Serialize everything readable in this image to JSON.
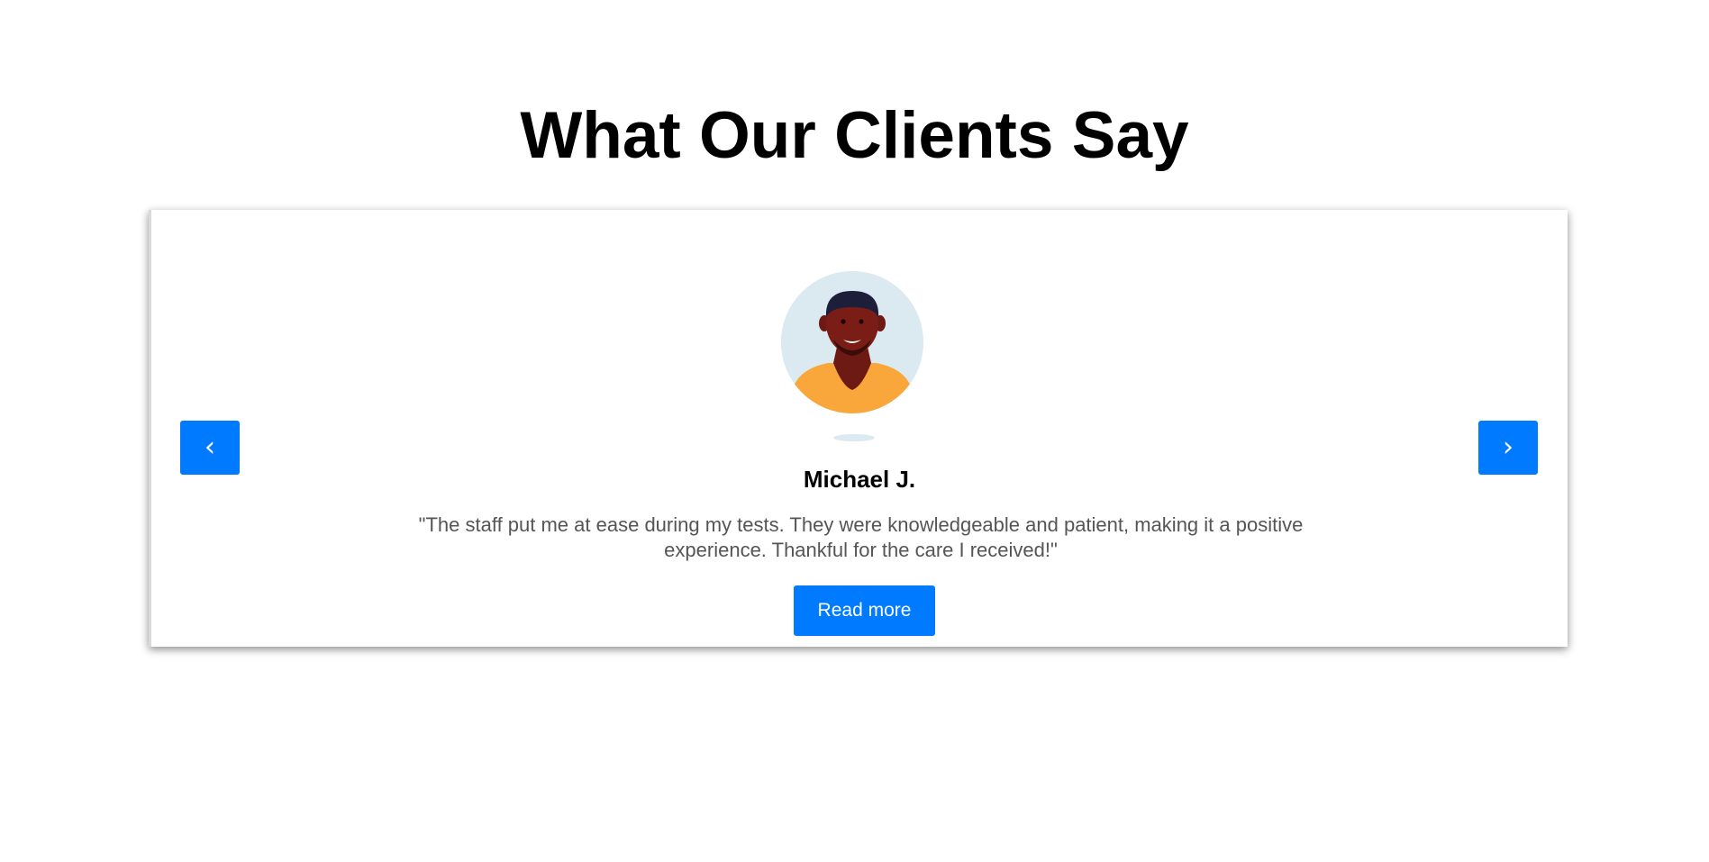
{
  "section": {
    "title": "What Our Clients Say"
  },
  "carousel": {
    "prev_label": "‹",
    "next_label": "›"
  },
  "testimonial": {
    "name": "Michael J.",
    "quote": "\"The staff put me at ease during my tests. They were knowledgeable and patient, making it a positive experience. Thankful for the care I received!\"",
    "read_more_label": "Read more",
    "avatar_icon": "person-avatar-icon"
  },
  "colors": {
    "accent": "#007bff",
    "avatar_background": "#dbeaf1",
    "quote_text": "#555555"
  }
}
